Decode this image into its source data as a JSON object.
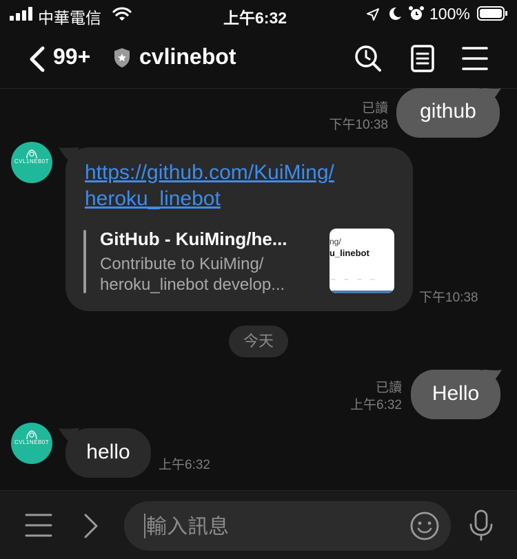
{
  "status_bar": {
    "carrier": "中華電信",
    "time": "上午6:32",
    "battery": "100%"
  },
  "header": {
    "unread_count": "99+",
    "room_title": "cvlinebot"
  },
  "messages": {
    "m1": {
      "text": "github",
      "read": "已讀",
      "time": "下午10:38"
    },
    "m2": {
      "link_line1": "https://github.com/KuiMing/",
      "link_line2": "heroku_linebot",
      "preview_title": "GitHub - KuiMing/he...",
      "preview_desc1": "Contribute to KuiMing/",
      "preview_desc2": "heroku_linebot develop...",
      "thumb_line1": "ng/",
      "thumb_line2": "u_linebot",
      "time": "下午10:38"
    },
    "date_chip": "今天",
    "m3": {
      "text": "Hello",
      "read": "已讀",
      "time": "上午6:32"
    },
    "m4": {
      "text": "hello",
      "time": "上午6:32"
    },
    "avatar_text": "CVL1NEB0T"
  },
  "composer": {
    "placeholder": "輸入訊息"
  },
  "colors": {
    "background": "#111111",
    "outgoing_bubble": "#5a5a5a",
    "incoming_bubble": "#2a2a2a",
    "link": "#3b8df0",
    "avatar": "#1fb89a"
  },
  "icons": [
    "wifi-icon",
    "location-arrow-icon",
    "moon-icon",
    "alarm-icon",
    "battery-icon",
    "back-chevron-icon",
    "shield-icon",
    "search-history-icon",
    "notes-icon",
    "menu-icon",
    "more-menu-icon",
    "chevron-right-icon",
    "emoji-icon",
    "microphone-icon"
  ]
}
